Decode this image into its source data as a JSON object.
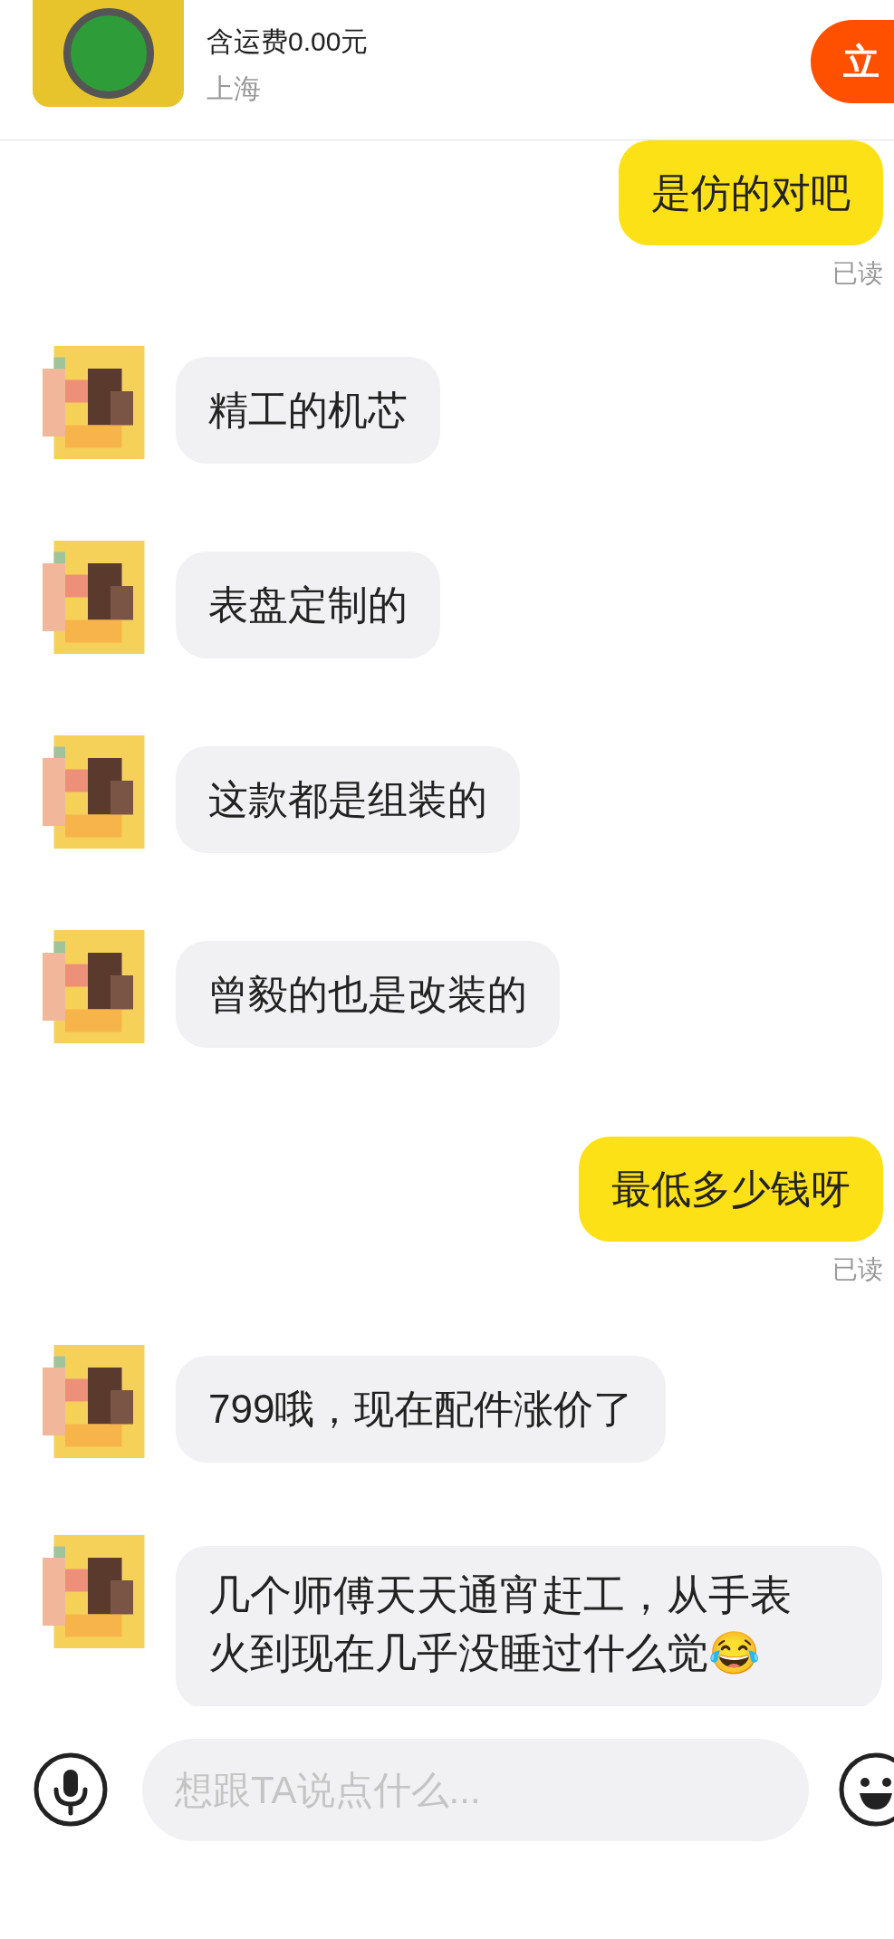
{
  "product": {
    "shipping": "含运费0.00元",
    "location": "上海",
    "buy_button": "立"
  },
  "messages": [
    {
      "kind": "sent",
      "text": "是仿的对吧",
      "status": "已读"
    },
    {
      "kind": "received",
      "text": "精工的机芯"
    },
    {
      "kind": "received",
      "text": "表盘定制的"
    },
    {
      "kind": "received",
      "text": "这款都是组装的"
    },
    {
      "kind": "received",
      "text": "曾毅的也是改装的"
    },
    {
      "kind": "sent",
      "text": "最低多少钱呀",
      "status": "已读"
    },
    {
      "kind": "received",
      "text": "799哦，现在配件涨价了"
    },
    {
      "kind": "received",
      "text": "几个师傅天天通宵赶工，从手表火到现在几乎没睡过什么觉😂"
    }
  ],
  "composer": {
    "placeholder": "想跟TA说点什么..."
  }
}
